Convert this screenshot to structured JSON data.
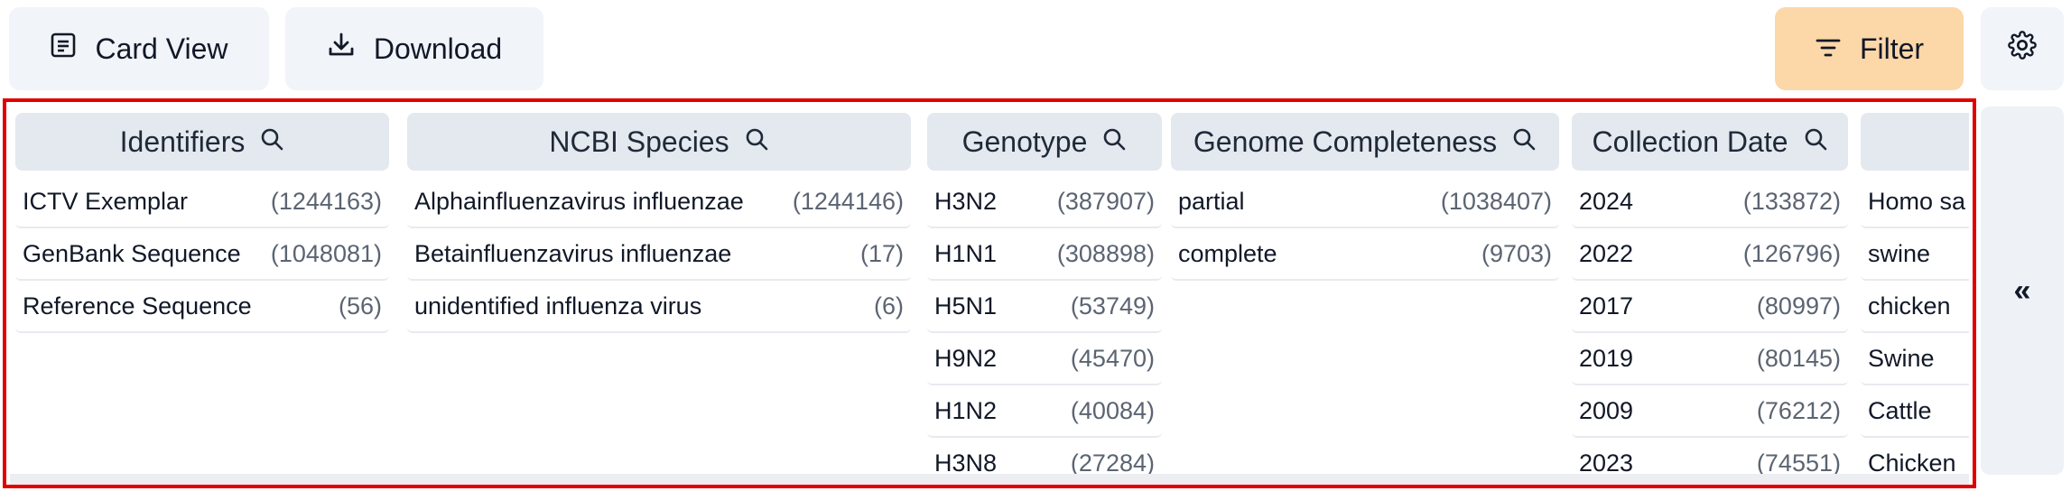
{
  "toolbar": {
    "card_view_label": "Card View",
    "download_label": "Download",
    "filter_label": "Filter",
    "card_view_icon": "card-list-icon",
    "download_icon": "download-icon",
    "filter_icon": "filter-lines-icon",
    "settings_icon": "gear-icon"
  },
  "colors": {
    "filter_button_bg": "#fcd7a8",
    "toolbar_button_bg": "#f1f4f8",
    "column_header_bg": "#e4e8ef",
    "highlight_border": "#e00000"
  },
  "columns": [
    {
      "title": "Identifiers",
      "rows": [
        {
          "label": "ICTV Exemplar",
          "count": "(1244163)"
        },
        {
          "label": "GenBank Sequence",
          "count": "(1048081)"
        },
        {
          "label": "Reference Sequence",
          "count": "(56)"
        }
      ]
    },
    {
      "title": "NCBI Species",
      "rows": [
        {
          "label": "Alphainfluenzavirus influenzae",
          "count": "(1244146)"
        },
        {
          "label": "Betainfluenzavirus influenzae",
          "count": "(17)"
        },
        {
          "label": "unidentified influenza virus",
          "count": "(6)"
        }
      ]
    },
    {
      "title": "Genotype",
      "rows": [
        {
          "label": "H3N2",
          "count": "(387907)"
        },
        {
          "label": "H1N1",
          "count": "(308898)"
        },
        {
          "label": "H5N1",
          "count": "(53749)"
        },
        {
          "label": "H9N2",
          "count": "(45470)"
        },
        {
          "label": "H1N2",
          "count": "(40084)"
        },
        {
          "label": "H3N8",
          "count": "(27284)"
        }
      ]
    },
    {
      "title": "Genome Completeness",
      "rows": [
        {
          "label": "partial",
          "count": "(1038407)"
        },
        {
          "label": "complete",
          "count": "(9703)"
        }
      ]
    },
    {
      "title": "Collection Date",
      "rows": [
        {
          "label": "2024",
          "count": "(133872)"
        },
        {
          "label": "2022",
          "count": "(126796)"
        },
        {
          "label": "2017",
          "count": "(80997)"
        },
        {
          "label": "2019",
          "count": "(80145)"
        },
        {
          "label": "2009",
          "count": "(76212)"
        },
        {
          "label": "2023",
          "count": "(74551)"
        }
      ]
    },
    {
      "title": "",
      "rows": [
        {
          "label": "Homo sa",
          "count": ""
        },
        {
          "label": "swine",
          "count": ""
        },
        {
          "label": "chicken",
          "count": ""
        },
        {
          "label": "Swine",
          "count": ""
        },
        {
          "label": "Cattle",
          "count": ""
        },
        {
          "label": "Chicken",
          "count": ""
        }
      ]
    }
  ],
  "collapse_panel": {
    "label": "«",
    "icon": "double-chevron-left-icon"
  }
}
